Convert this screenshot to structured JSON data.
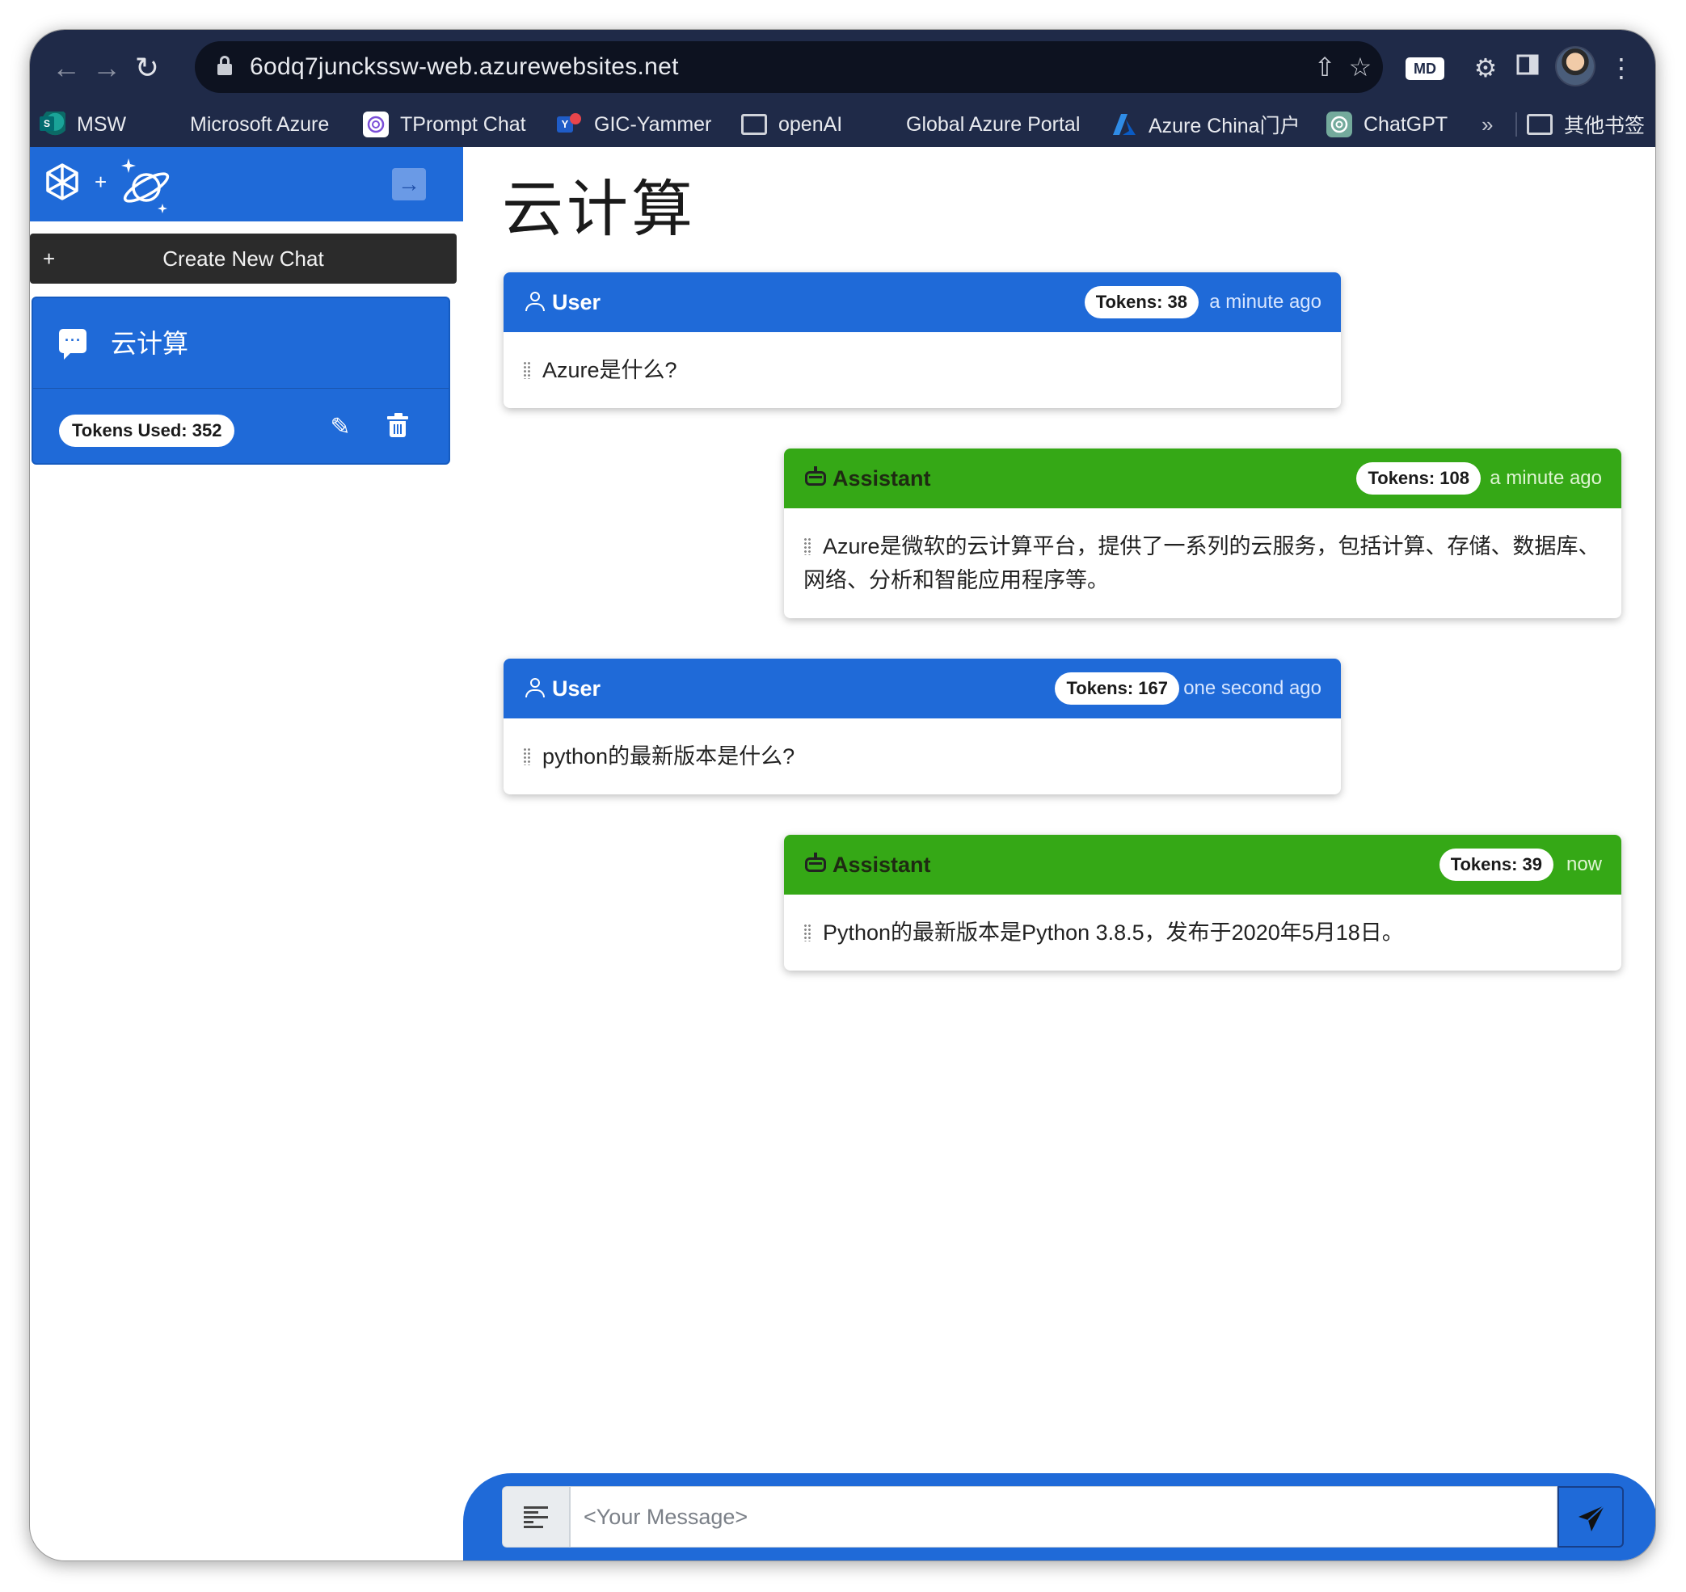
{
  "browser": {
    "url": "6odq7junckssw-web.azurewebsites.net",
    "bookmarks": [
      {
        "label": "MSW",
        "icon": "sharepoint-icon"
      },
      {
        "label": "Microsoft Azure",
        "icon": "microsoft-logo-icon"
      },
      {
        "label": "TPrompt Chat",
        "icon": "openai-icon"
      },
      {
        "label": "GIC-Yammer",
        "icon": "yammer-icon"
      },
      {
        "label": "openAI",
        "icon": "folder-icon"
      },
      {
        "label": "Global Azure Portal",
        "icon": "microsoft-logo-icon"
      },
      {
        "label": "Azure China门户",
        "icon": "azure-icon"
      },
      {
        "label": "ChatGPT",
        "icon": "chatgpt-icon"
      }
    ],
    "more_bookmarks": "»",
    "other_bookmarks": "其他书签",
    "extension_badge": "MD"
  },
  "sidebar": {
    "new_chat_label": "Create New Chat",
    "new_chat_plus": "+",
    "chats": [
      {
        "title": "云计算",
        "tokens_used": "Tokens Used: 352"
      }
    ]
  },
  "main": {
    "title": "云计算",
    "messages": [
      {
        "role": "User",
        "tokens": "Tokens: 38",
        "time": "a minute ago",
        "text": "Azure是什么?"
      },
      {
        "role": "Assistant",
        "tokens": "Tokens: 108",
        "time": "a minute ago",
        "text": "Azure是微软的云计算平台，提供了一系列的云服务，包括计算、存储、数据库、网络、分析和智能应用程序等。"
      },
      {
        "role": "User",
        "tokens": "Tokens: 167",
        "time": "one second ago",
        "text": "python的最新版本是什么?"
      },
      {
        "role": "Assistant",
        "tokens": "Tokens: 39",
        "time": "now",
        "text": "Python的最新版本是Python 3.8.5，发布于2020年5月18日。"
      }
    ],
    "input_placeholder": "<Your Message>"
  },
  "colors": {
    "user_header": "#1f6ad8",
    "assistant_header": "#35a816",
    "browser_chrome": "#1f2a48",
    "new_chat_button": "#2b2b2b"
  }
}
